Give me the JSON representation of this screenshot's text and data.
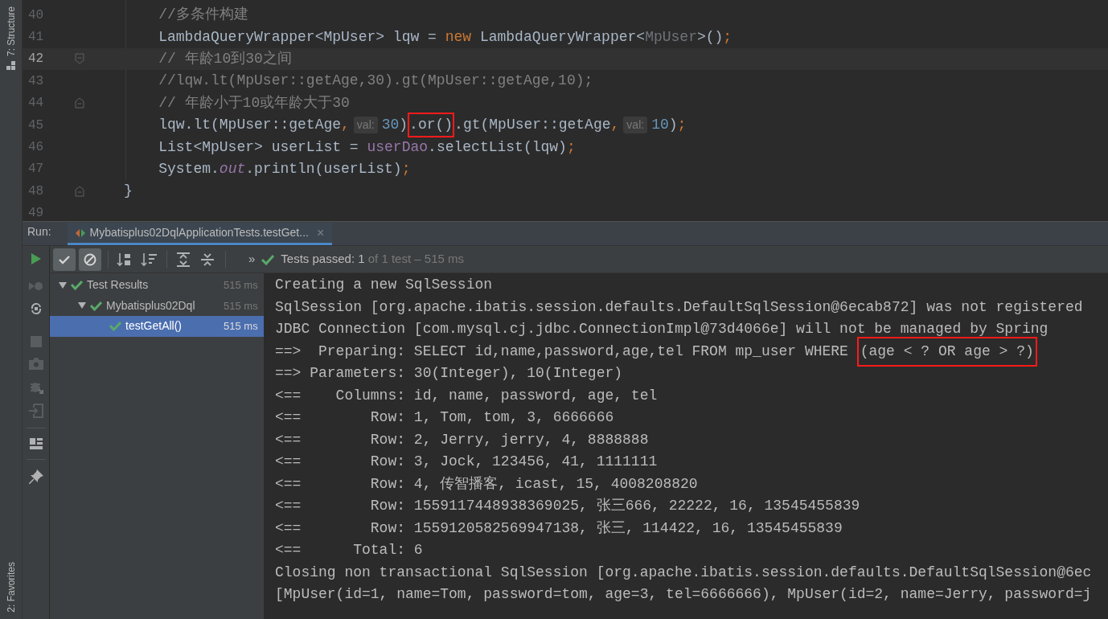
{
  "tool_strip": {
    "top_label": "7: Structure",
    "bottom_label": "2: Favorites"
  },
  "editor": {
    "lines": [
      {
        "number": "40",
        "current": false,
        "segments": [
          {
            "kind": "comment",
            "text": "    //多条件构建"
          }
        ]
      },
      {
        "number": "41",
        "current": false,
        "segments": [
          {
            "kind": "plain",
            "text": "    LambdaQueryWrapper<MpUser> lqw = "
          },
          {
            "kind": "keyword",
            "text": "new"
          },
          {
            "kind": "plain",
            "text": " LambdaQueryWrapper<"
          },
          {
            "kind": "generic",
            "text": "MpUser"
          },
          {
            "kind": "plain",
            "text": ">()"
          },
          {
            "kind": "punct",
            "text": ";"
          }
        ]
      },
      {
        "number": "42",
        "current": true,
        "fold": {
          "kind": "start"
        },
        "segments": [
          {
            "kind": "comment",
            "text": "    // 年龄10到30之间"
          }
        ]
      },
      {
        "number": "43",
        "current": false,
        "segments": [
          {
            "kind": "comment",
            "text": "    //lqw.lt(MpUser::getAge,30).gt(MpUser::getAge,10);"
          }
        ]
      },
      {
        "number": "44",
        "current": false,
        "fold": {
          "kind": "end"
        },
        "segments": [
          {
            "kind": "comment",
            "text": "    // 年龄小于10或年龄大于30"
          }
        ]
      },
      {
        "number": "45",
        "current": false,
        "segments": [
          {
            "kind": "plain",
            "text": "    lqw.lt(MpUser::getAge"
          },
          {
            "kind": "punct",
            "text": ","
          },
          {
            "kind": "hint",
            "text": "val:"
          },
          {
            "kind": "number",
            "text": "30"
          },
          {
            "kind": "plain",
            "text": ")"
          },
          {
            "kind": "plain",
            "text": ".or()",
            "boxed": true
          },
          {
            "kind": "plain",
            "text": ".gt(MpUser::getAge"
          },
          {
            "kind": "punct",
            "text": ","
          },
          {
            "kind": "hint",
            "text": "val:"
          },
          {
            "kind": "number",
            "text": "10"
          },
          {
            "kind": "plain",
            "text": ")"
          },
          {
            "kind": "punct",
            "text": ";"
          }
        ]
      },
      {
        "number": "46",
        "current": false,
        "segments": [
          {
            "kind": "plain",
            "text": "    List<MpUser> userList = "
          },
          {
            "kind": "field",
            "text": "userDao"
          },
          {
            "kind": "plain",
            "text": ".selectList(lqw)"
          },
          {
            "kind": "punct",
            "text": ";"
          }
        ]
      },
      {
        "number": "47",
        "current": false,
        "segments": [
          {
            "kind": "plain",
            "text": "    System."
          },
          {
            "kind": "static_field",
            "text": "out"
          },
          {
            "kind": "plain",
            "text": ".println(userList)"
          },
          {
            "kind": "punct",
            "text": ";"
          }
        ]
      },
      {
        "number": "48",
        "current": false,
        "fold": {
          "kind": "end"
        },
        "segments": [
          {
            "kind": "plain",
            "text": "}"
          }
        ]
      },
      {
        "number": "49",
        "current": false
      }
    ]
  },
  "run_panel": {
    "label": "Run:",
    "tab": {
      "title": "Mybatisplus02DqlApplicationTests.testGet...",
      "close": "×",
      "selected": true
    },
    "toolbar": {
      "toggles": [
        {
          "kind": "passed",
          "selected": true
        },
        {
          "kind": "ignored",
          "selected": true
        }
      ],
      "more": "»",
      "status_main": "Tests passed: 1",
      "status_detail": "of 1 test – 515 ms"
    },
    "tree": [
      {
        "label": "Test Results",
        "time": "515 ms",
        "expanded": true,
        "selected": false,
        "children": [
          {
            "label": "Mybatisplus02Dql",
            "time": "515 ms",
            "expanded": true,
            "selected": false,
            "children": [
              {
                "label": "testGetAll()",
                "time": "515 ms",
                "selected": true
              }
            ]
          }
        ]
      }
    ],
    "console": [
      {
        "segments": [
          {
            "text": "Creating a new SqlSession"
          }
        ]
      },
      {
        "segments": [
          {
            "text": "SqlSession [org.apache.ibatis.session.defaults.DefaultSqlSession@6ecab872] was not registered"
          }
        ]
      },
      {
        "segments": [
          {
            "text": "JDBC Connection [com.mysql.cj.jdbc.ConnectionImpl@73d4066e] will not be managed by Spring"
          }
        ]
      },
      {
        "segments": [
          {
            "text": "==>  Preparing: SELECT id,name,password,age,tel FROM mp_user WHERE "
          },
          {
            "text": "(age < ? OR age > ?)",
            "boxed": true
          }
        ]
      },
      {
        "segments": [
          {
            "text": "==> Parameters: 30(Integer), 10(Integer)"
          }
        ]
      },
      {
        "segments": [
          {
            "text": "<==    Columns: id, name, password, age, tel"
          }
        ]
      },
      {
        "segments": [
          {
            "text": "<==        Row: 1, Tom, tom, 3, 6666666"
          }
        ]
      },
      {
        "segments": [
          {
            "text": "<==        Row: 2, Jerry, jerry, 4, 8888888"
          }
        ]
      },
      {
        "segments": [
          {
            "text": "<==        Row: 3, Jock, 123456, 41, 1111111"
          }
        ]
      },
      {
        "segments": [
          {
            "text": "<==        Row: 4, 传智播客, icast, 15, 4008208820"
          }
        ]
      },
      {
        "segments": [
          {
            "text": "<==        Row: 1559117448938369025, 张三666, 22222, 16, 13545455839"
          }
        ]
      },
      {
        "segments": [
          {
            "text": "<==        Row: 1559120582569947138, 张三, 114422, 16, 13545455839"
          }
        ]
      },
      {
        "segments": [
          {
            "text": "<==      Total: 6"
          }
        ]
      },
      {
        "segments": [
          {
            "text": "Closing non transactional SqlSession [org.apache.ibatis.session.defaults.DefaultSqlSession@6ec"
          }
        ]
      },
      {
        "segments": [
          {
            "text": "[MpUser(id=1, name=Tom, password=tom, age=3, tel=6666666), MpUser(id=2, name=Jerry, password=j"
          }
        ]
      }
    ]
  }
}
